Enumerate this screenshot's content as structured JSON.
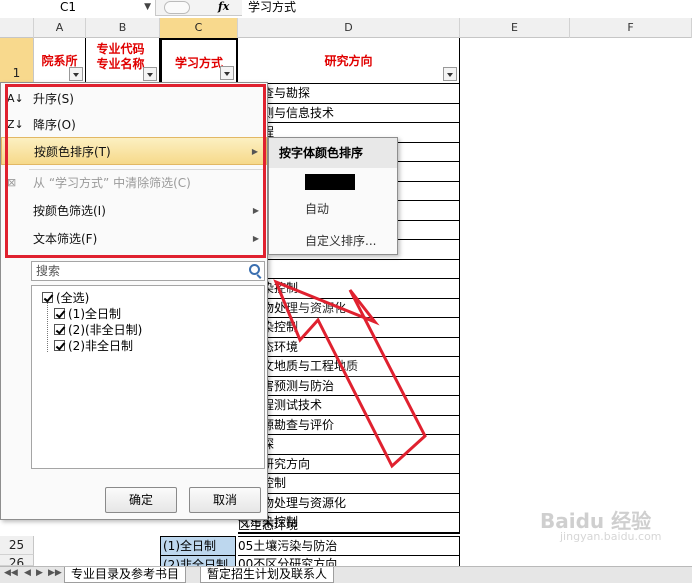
{
  "formula_bar": {
    "cell_ref": "C1",
    "fx": "fx",
    "content": "学习方式"
  },
  "columns": [
    "A",
    "B",
    "C",
    "D",
    "E",
    "F"
  ],
  "rows": {
    "first": "1",
    "r25": "25",
    "r26": "26"
  },
  "headers": {
    "a": "院系所",
    "b": "专业代码 专业名称",
    "c": "学习方式",
    "d": "研究方向"
  },
  "column_d": [
    "矿普查与勘探",
    "球探测与信息技术",
    "质工程",
    "",
    "",
    "",
    "",
    "",
    "",
    "",
    "",
    "",
    "",
    "",
    "",
    "",
    "",
    "壤污染控制",
    "体废物处理与资源化",
    "气污染控制",
    "区生态环境",
    "井水文地质与工程地质",
    "质灾害预测与防治",
    "土工程测试技术",
    "水资源勘查与评价",
    "井物探",
    "区分研究方向",
    "污染控制",
    "体废物处理与资源化",
    "气污染控制",
    "区生态环境"
  ],
  "bottom_rows": {
    "r25_c": "(1)全日制",
    "r25_d": "05土壤污染与防治",
    "r26_c": "(2)非全日制",
    "r26_d": "00不区分研究方向"
  },
  "filter_menu": {
    "sort_asc": "升序(S)",
    "sort_desc": "降序(O)",
    "sort_by_color": "按颜色排序(T)",
    "clear_filter": "从 “学习方式” 中清除筛选(C)",
    "filter_by_color": "按颜色筛选(I)",
    "text_filter": "文本筛选(F)",
    "search_placeholder": "搜索",
    "tree": [
      "(全选)",
      "(1)全日制",
      "(2)(非全日制)",
      "(2)非全日制"
    ],
    "ok": "确定",
    "cancel": "取消"
  },
  "submenu": {
    "title": "按字体颜色排序",
    "swatch_color": "#000000",
    "auto": "自动",
    "custom": "自定义排序..."
  },
  "sheet_tabs": [
    "专业目录及参考书目",
    "暂定招生计划及联系人"
  ],
  "watermark": {
    "main": "Baidu 经验",
    "sub": "jingyan.baidu.com"
  },
  "colors": {
    "highlight": "#e0212f",
    "header_text": "#e00000",
    "selected_fill": "#bdd7ee",
    "active_header": "#f8d98d"
  }
}
